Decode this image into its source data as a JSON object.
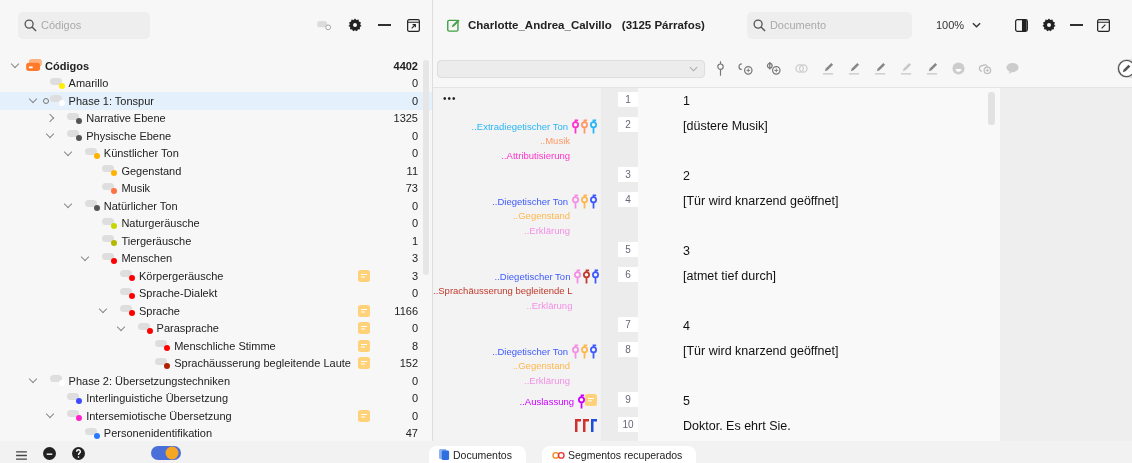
{
  "codes_panel": {
    "search": {
      "placeholder": "Códigos"
    }
  },
  "codes": {
    "title": "Códigos",
    "count": "4402",
    "expanded": true,
    "children": [
      {
        "name": "Amarillo",
        "count": "0",
        "color": "#ffee00",
        "selected": false,
        "memo": false
      },
      {
        "name": "Phase 1: Tonspur",
        "count": "0",
        "color": "#ffffff",
        "selected": true,
        "memo": false,
        "expanded": true,
        "children": [
          {
            "name": "Narrative Ebene",
            "count": "1325",
            "color": "#555555",
            "selected": false,
            "memo": false,
            "expanded": false
          },
          {
            "name": "Physische Ebene",
            "count": "0",
            "color": "#555555",
            "selected": false,
            "memo": false,
            "expanded": true,
            "children": [
              {
                "name": "Künstlicher Ton",
                "count": "0",
                "color": "#ffb300",
                "selected": false,
                "memo": false,
                "expanded": true,
                "children": [
                  {
                    "name": "Gegenstand",
                    "count": "11",
                    "color": "#ffb300",
                    "selected": false,
                    "memo": false
                  },
                  {
                    "name": "Musik",
                    "count": "73",
                    "color": "#ff7043",
                    "selected": false,
                    "memo": false
                  }
                ]
              },
              {
                "name": "Natürlicher Ton",
                "count": "0",
                "color": "#555555",
                "selected": false,
                "memo": false,
                "expanded": true,
                "children": [
                  {
                    "name": "Naturgeräusche",
                    "count": "0",
                    "color": "#c6d600",
                    "selected": false,
                    "memo": false
                  },
                  {
                    "name": "Tiergeräusche",
                    "count": "1",
                    "color": "#b5b800",
                    "selected": false,
                    "memo": false
                  },
                  {
                    "name": "Menschen",
                    "count": "3",
                    "color": "#ff0000",
                    "selected": false,
                    "memo": false,
                    "expanded": true,
                    "children": [
                      {
                        "name": "Körpergeräusche",
                        "count": "3",
                        "color": "#ff0000",
                        "selected": false,
                        "memo": true
                      },
                      {
                        "name": "Sprache-Dialekt",
                        "count": "0",
                        "color": "#ff0000",
                        "selected": false,
                        "memo": false
                      },
                      {
                        "name": "Sprache",
                        "count": "1166",
                        "color": "#ff0000",
                        "selected": false,
                        "memo": true,
                        "expanded": true,
                        "children": [
                          {
                            "name": "Parasprache",
                            "count": "0",
                            "color": "#ff0000",
                            "selected": false,
                            "memo": true,
                            "expanded": true,
                            "children": [
                              {
                                "name": "Menschliche Stimme",
                                "count": "8",
                                "color": "#ff0000",
                                "selected": false,
                                "memo": true
                              },
                              {
                                "name": "Sprachäusserung begleitende Laute",
                                "count": "152",
                                "color": "#b22000",
                                "selected": false,
                                "memo": true
                              }
                            ]
                          }
                        ]
                      }
                    ]
                  }
                ]
              }
            ]
          }
        ]
      },
      {
        "name": "Phase 2: Übersetzungstechniken",
        "count": "0",
        "color": "#ffffff",
        "selected": false,
        "memo": false,
        "expanded": true,
        "children": [
          {
            "name": "Interlinguistiche Übersetzung",
            "count": "0",
            "color": "#3d4bff",
            "selected": false,
            "memo": false
          },
          {
            "name": "Intersemiotische Übersetzung",
            "count": "0",
            "color": "#ff22cc",
            "selected": false,
            "memo": true,
            "expanded": true,
            "children": [
              {
                "name": "Personenidentifikation",
                "count": "47",
                "color": "#2979ff",
                "selected": false,
                "memo": false
              }
            ]
          }
        ]
      }
    ]
  },
  "document": {
    "title": "Charlotte_Andrea_Calvillo",
    "paragraph_count": "(3125 Párrafos)",
    "search": {
      "placeholder": "Documento"
    },
    "zoom": "100%"
  },
  "paragraphs": [
    {
      "number": "1",
      "text": "1",
      "margin_note": "•••",
      "memo": false
    },
    {
      "number": "2",
      "text": "[düstere Musik]",
      "code_labels": [
        "..Extradiegetischer Ton",
        "..Musik",
        "..Attributisierung"
      ],
      "markers": [
        {
          "color": "#ff33cc"
        },
        {
          "color": "#ff9966"
        },
        {
          "color": "#29b6f6"
        }
      ],
      "memo": false
    },
    {
      "number": "3",
      "text": "2",
      "memo": false
    },
    {
      "number": "4",
      "text": "[Tür wird knarzend geöffnet]",
      "code_labels": [
        "..Diegetischer Ton",
        "..Gegenstand",
        "..Erklärung"
      ],
      "markers": [
        {
          "color": "#f48fe6"
        },
        {
          "color": "#ffb74d"
        },
        {
          "color": "#3d5afe"
        }
      ],
      "memo": false
    },
    {
      "number": "5",
      "text": "3",
      "memo": false
    },
    {
      "number": "6",
      "text": "[atmet tief durch]",
      "code_labels": [
        "..Diegetischer Ton",
        "..Sprachäusserung begleitende L",
        "..Erklärung"
      ],
      "markers": [
        {
          "color": "#f48fe6"
        },
        {
          "color": "#c0392b"
        },
        {
          "color": "#3d5afe"
        }
      ],
      "memo": false
    },
    {
      "number": "7",
      "text": "4",
      "memo": false
    },
    {
      "number": "8",
      "text": "[Tür wird knarzend geöffnet]",
      "code_labels": [
        "..Diegetischer Ton",
        "..Gegenstand",
        "..Erklärung"
      ],
      "markers": [
        {
          "color": "#f48fe6"
        },
        {
          "color": "#ffb74d"
        },
        {
          "color": "#3d5afe"
        }
      ],
      "memo": false
    },
    {
      "number": "9",
      "text": "5",
      "code_labels": [
        "..Auslassung"
      ],
      "markers": [
        {
          "color": "#cc00ff"
        }
      ],
      "memo": true
    },
    {
      "number": "10",
      "text": "Doktor. Es ehrt Sie.",
      "segment_marks": [
        {
          "color": "#d32f2f"
        },
        {
          "color": "#d32f2f"
        },
        {
          "color": "#1e4fd8"
        }
      ],
      "memo": false
    }
  ],
  "bottom_tabs": [
    {
      "label": "Documentos",
      "kind": "documents"
    },
    {
      "label": "Segmentos recuperados",
      "kind": "segments"
    }
  ]
}
